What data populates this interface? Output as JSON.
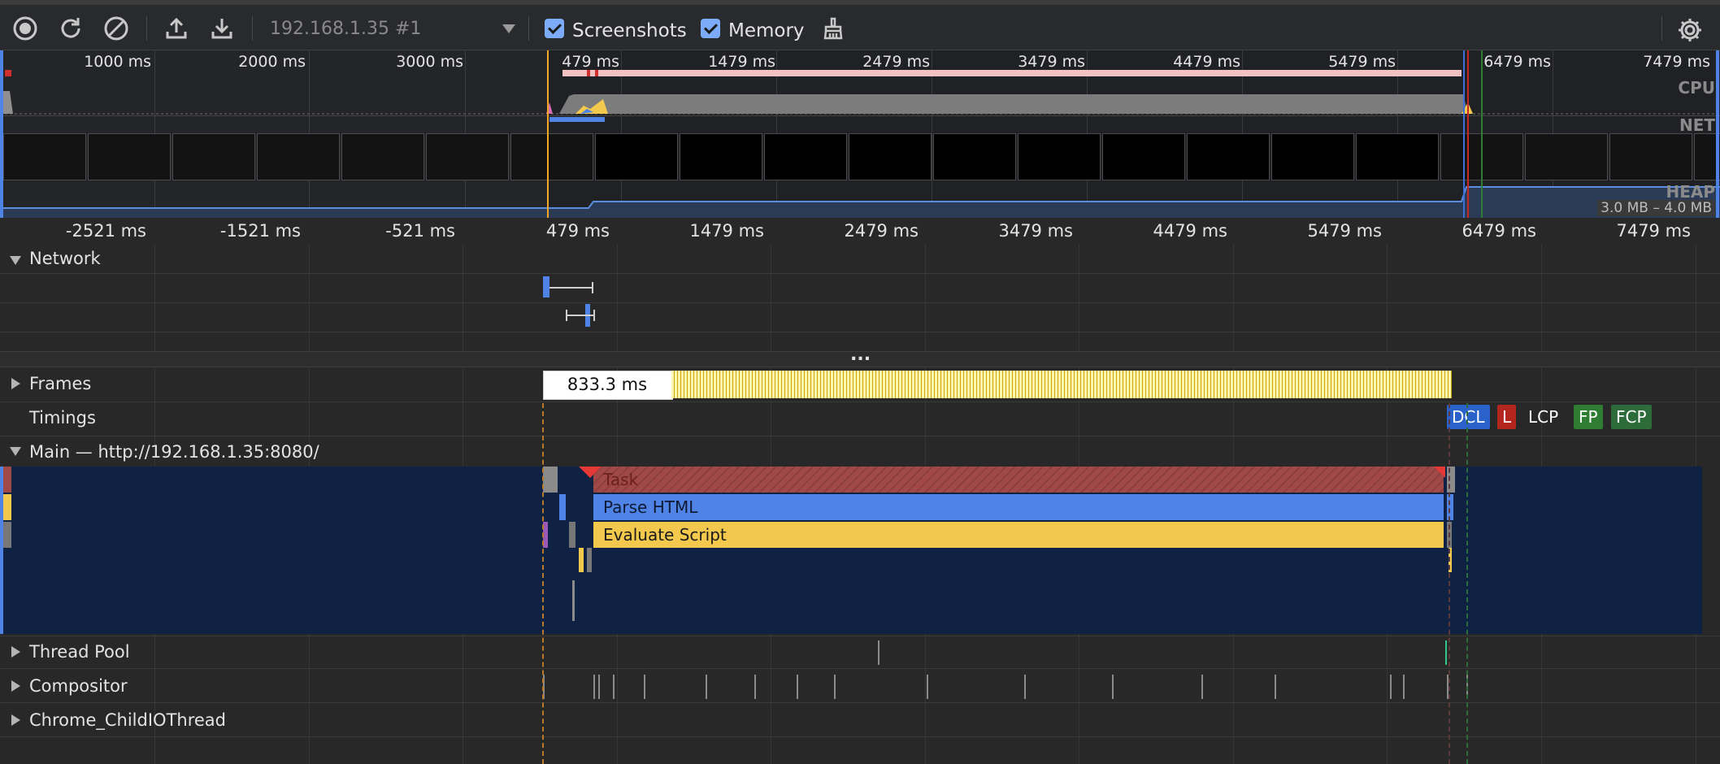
{
  "toolbar": {
    "target": "192.168.1.35 #1",
    "screenshots_label": "Screenshots",
    "memory_label": "Memory",
    "screenshots_checked": true,
    "memory_checked": true
  },
  "overview": {
    "top_labels": [
      "1000 ms",
      "2000 ms",
      "3000 ms",
      "479 ms",
      "1479 ms",
      "2479 ms",
      "3479 ms",
      "4479 ms",
      "5479 ms",
      "6479 ms",
      "7479 ms"
    ],
    "cpu_label": "CPU",
    "net_label": "NET",
    "heap_label": "HEAP",
    "heap_range": "3.0 MB – 4.0 MB"
  },
  "ruler": {
    "labels": [
      "-2521 ms",
      "-1521 ms",
      "-521 ms",
      "479 ms",
      "1479 ms",
      "2479 ms",
      "3479 ms",
      "4479 ms",
      "5479 ms",
      "6479 ms",
      "7479 ms"
    ]
  },
  "tracks": {
    "network": "Network",
    "more": "...",
    "frames": "Frames",
    "frame_duration": "833.3 ms",
    "timings": "Timings",
    "main": "Main — http://192.168.1.35:8080/",
    "thread_pool": "Thread Pool",
    "compositor": "Compositor",
    "io_thread": "Chrome_ChildIOThread"
  },
  "timings": {
    "dcl": "DCL",
    "l": "L",
    "lcp": "LCP",
    "fp": "FP",
    "fcp": "FCP"
  },
  "flame": {
    "task": "Task",
    "parse_html": "Parse HTML",
    "evaluate_script": "Evaluate Script"
  },
  "colors": {
    "accent_blue": "#7cacf8",
    "dcl": "#2a62c9",
    "load": "#b3261e",
    "paint": "#2e7d32",
    "task": "#a14949",
    "parse_html": "#4f84e6",
    "evaluate_script": "#f2c94c",
    "main_background": "#0f2244"
  }
}
